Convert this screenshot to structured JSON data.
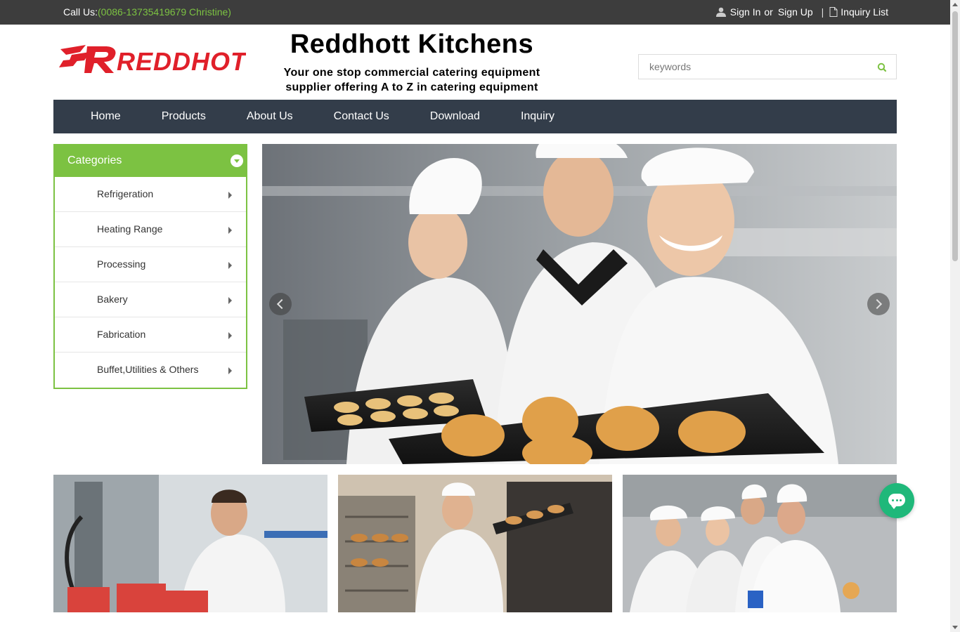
{
  "topbar": {
    "call_label": "Call Us:",
    "call_number": "(0086-13735419679 Christine)",
    "sign_in": "Sign In",
    "or": "or",
    "sign_up": "Sign Up",
    "separator": "|",
    "inquiry_list": "Inquiry List"
  },
  "header": {
    "logo_text": "REDDHOTT",
    "title": "Reddhott Kitchens",
    "subtitle_line1": "Your one stop commercial catering equipment",
    "subtitle_line2": "supplier offering A to Z in catering equipment"
  },
  "search": {
    "placeholder": "keywords",
    "icon": "search-icon"
  },
  "nav": {
    "items": [
      "Home",
      "Products",
      "About Us",
      "Contact Us",
      "Download",
      "Inquiry"
    ]
  },
  "categories": {
    "title": "Categories",
    "items": [
      "Refrigeration",
      "Heating Range",
      "Processing",
      "Bakery",
      "Fabrication",
      "Buffet,Utilities & Others"
    ]
  },
  "colors": {
    "accent": "#7cc242",
    "topbar": "#3d3d3d",
    "nav": "#333d4a",
    "chat": "#1fb87a",
    "brand_red": "#e0202a"
  }
}
